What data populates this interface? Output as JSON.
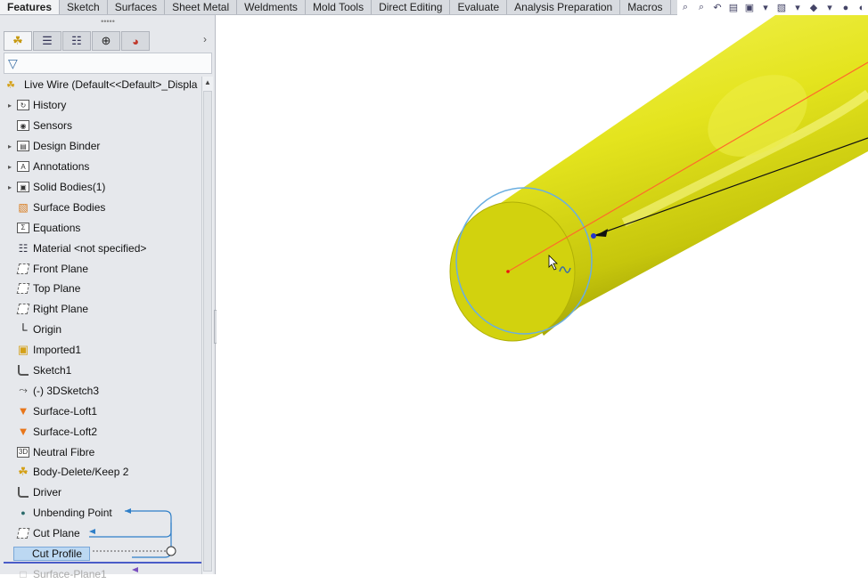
{
  "tabs": [
    "Features",
    "Sketch",
    "Surfaces",
    "Sheet Metal",
    "Weldments",
    "Mold Tools",
    "Direct Editing",
    "Evaluate",
    "Analysis Preparation",
    "Macros"
  ],
  "active_tab": "Features",
  "root": {
    "label": "Live Wire  (Default<<Default>_Displa"
  },
  "tree": [
    {
      "label": "History",
      "icon": "history-icon",
      "caret": true
    },
    {
      "label": "Sensors",
      "icon": "sensor-icon",
      "caret": false
    },
    {
      "label": "Design Binder",
      "icon": "binder-icon",
      "caret": true
    },
    {
      "label": "Annotations",
      "icon": "annotation-icon",
      "caret": true
    },
    {
      "label": "Solid Bodies(1)",
      "icon": "solid-bodies-icon",
      "caret": true
    },
    {
      "label": "Surface Bodies",
      "icon": "surface-bodies-icon",
      "caret": false
    },
    {
      "label": "Equations",
      "icon": "equations-icon",
      "caret": false
    },
    {
      "label": "Material <not specified>",
      "icon": "material-icon",
      "caret": false
    },
    {
      "label": "Front Plane",
      "icon": "plane-icon",
      "caret": false
    },
    {
      "label": "Top Plane",
      "icon": "plane-icon",
      "caret": false
    },
    {
      "label": "Right Plane",
      "icon": "plane-icon",
      "caret": false
    },
    {
      "label": "Origin",
      "icon": "origin-icon",
      "caret": false
    },
    {
      "label": "Imported1",
      "icon": "imported-icon",
      "caret": false
    },
    {
      "label": "Sketch1",
      "icon": "sketch-icon",
      "caret": false
    },
    {
      "label": "(-) 3DSketch3",
      "icon": "3dsketch-icon",
      "caret": false
    },
    {
      "label": "Surface-Loft1",
      "icon": "loft-icon",
      "caret": false
    },
    {
      "label": "Surface-Loft2",
      "icon": "loft-icon",
      "caret": false
    },
    {
      "label": "Neutral Fibre",
      "icon": "3d-icon",
      "caret": false
    },
    {
      "label": "Body-Delete/Keep 2",
      "icon": "body-delete-icon",
      "caret": false
    },
    {
      "label": "Driver",
      "icon": "sketch-icon",
      "caret": false
    },
    {
      "label": "Unbending Point",
      "icon": "point-icon",
      "caret": false
    },
    {
      "label": "Cut Plane",
      "icon": "plane-icon",
      "caret": false
    },
    {
      "label": "Cut Profile",
      "icon": "sketch-icon",
      "caret": false,
      "selected": true
    },
    {
      "label": "Surface-Plane1",
      "icon": "surface-plane-icon",
      "caret": false,
      "dim": true
    }
  ],
  "colors": {
    "model_yellow": "#e6e620",
    "model_shadow": "#b8b80a",
    "circle_blue": "#6aaee0",
    "axis_orange": "#ff6a2a",
    "tree_arrow_blue": "#2f7fc8",
    "rollback_bar": "#4a5cc8"
  }
}
